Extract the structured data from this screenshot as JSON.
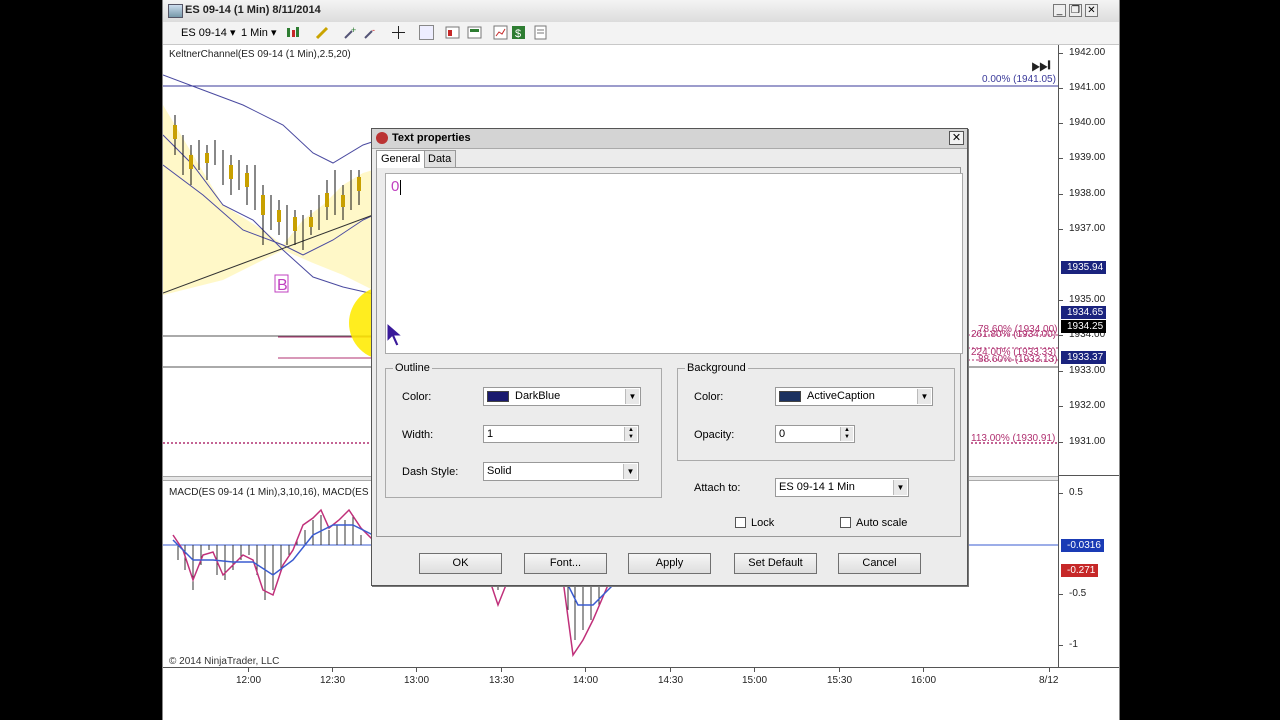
{
  "window": {
    "title": "ES 09-14 (1 Min)  8/11/2014",
    "controls": {
      "minimize": "_",
      "restore": "❐",
      "close": "✕"
    }
  },
  "toolbar": {
    "instrument": "ES 09-14",
    "interval": "1 Min",
    "dropdown_arrow": "▾"
  },
  "chart": {
    "keltner_label": "KeltnerChannel(ES 09-14 (1 Min),2.5,20)",
    "macd_label": "MACD(ES 09-14 (1 Min),3,10,16), MACD(ES",
    "copyright": "© 2014 NinjaTrader, LLC",
    "marker_letter": "B",
    "price_ticks": [
      "1942.00",
      "1941.00",
      "1940.00",
      "1939.00",
      "1938.00",
      "1937.00",
      "1935.00",
      "1934.00",
      "1933.00",
      "1932.00",
      "1931.00"
    ],
    "macd_ticks": [
      "0.5",
      "-0.5",
      "-1"
    ],
    "tags": [
      {
        "text": "1935.94",
        "color": "#1a237e"
      },
      {
        "text": "1934.65",
        "color": "#1a237e"
      },
      {
        "text": "1934.25",
        "color": "#000000"
      },
      {
        "text": "1933.37",
        "color": "#1a237e"
      },
      {
        "text": "-0.0316",
        "color": "#1a3bb5"
      },
      {
        "text": "-0.271",
        "color": "#c62828"
      }
    ],
    "fib_labels": [
      {
        "text": "0.00% (1941.05)",
        "color": "#3a3a9a"
      },
      {
        "text": "78.60% (1934.00)",
        "color": "#b03070"
      },
      {
        "text": "261.80% (1934.00)",
        "color": "#b03070"
      },
      {
        "text": "224.00% (1933.33)",
        "color": "#b03070"
      },
      {
        "text": "88.60% (1933.13)",
        "color": "#b03070"
      },
      {
        "text": "113.00% (1930.91)",
        "color": "#b03070"
      }
    ],
    "time_ticks": [
      "12:00",
      "12:30",
      "13:00",
      "13:30",
      "14:00",
      "14:30",
      "15:00",
      "15:30",
      "16:00",
      "8/12"
    ],
    "play_icon": "⏭"
  },
  "dialog": {
    "title": "Text properties",
    "close": "✕",
    "tabs": [
      "General",
      "Data"
    ],
    "text_value": "0",
    "outline": {
      "legend": "Outline",
      "color_label": "Color:",
      "color_value": "DarkBlue",
      "color_swatch": "#1a1a6e",
      "width_label": "Width:",
      "width_value": "1",
      "dash_label": "Dash Style:",
      "dash_value": "Solid"
    },
    "background": {
      "legend": "Background",
      "color_label": "Color:",
      "color_value": "ActiveCaption",
      "color_swatch": "#1b3160",
      "opacity_label": "Opacity:",
      "opacity_value": "0"
    },
    "attach_label": "Attach to:",
    "attach_value": "ES 09-14 1 Min",
    "lock_label": "Lock",
    "autoscale_label": "Auto scale",
    "buttons": {
      "ok": "OK",
      "font": "Font...",
      "apply": "Apply",
      "set_default": "Set Default",
      "cancel": "Cancel"
    }
  }
}
